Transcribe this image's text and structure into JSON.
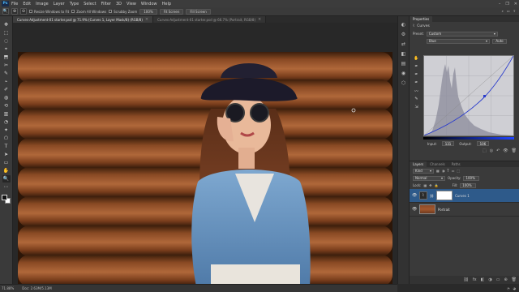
{
  "menu": {
    "logo": "Ps",
    "items": [
      "File",
      "Edit",
      "Image",
      "Layer",
      "Type",
      "Select",
      "Filter",
      "3D",
      "View",
      "Window",
      "Help"
    ],
    "window_controls": [
      "–",
      "❐",
      "✕"
    ]
  },
  "options": {
    "resize_windows_label": "Resize Windows to Fit",
    "zoom_all_label": "Zoom All Windows",
    "scrubby_zoom_label": "Scrubby Zoom",
    "zoom_100": "100%",
    "fit_screen": "Fit Screen",
    "fill_screen": "Fill Screen"
  },
  "tabs": [
    {
      "label": "Curves-Adjustment-01 starter.psd @ 71.9% (Curves 1, Layer Mask/8) (RGB/8)",
      "active": true,
      "close": "×"
    },
    {
      "label": "Curves-Adjustment-01 starter.psd @ 66.7% (Portrait, RGB/8)",
      "active": false,
      "close": "×"
    }
  ],
  "tools": [
    "✥",
    "⬚",
    "◌",
    "⌖",
    "⬒",
    "✂",
    "✎",
    "⌁",
    "✐",
    "◍",
    "⟲",
    "▥",
    "◔",
    "✦",
    "⬠",
    "T",
    "➤",
    "▭",
    "✋",
    "🔍",
    "⋯"
  ],
  "strip_icons": [
    "◐",
    "⚙",
    "⇄",
    "◧",
    "▤",
    "◉",
    "⬡"
  ],
  "properties": {
    "tabs": [
      "Properties"
    ],
    "header_label": "Curves",
    "preset_label": "Preset:",
    "preset_value": "Custom",
    "channel_value": "Blue",
    "auto_label": "Auto",
    "curve_tools": [
      "✋",
      "✒",
      "✒",
      "✒",
      "〰",
      "✎",
      "⇲"
    ],
    "input_label": "Input:",
    "input_value": "131",
    "output_label": "Output:",
    "output_value": "106",
    "foot_icons": [
      "⬚",
      "◎",
      "↶",
      "👁",
      "🗑"
    ]
  },
  "layers": {
    "tabs": [
      "Layers",
      "Channels",
      "Paths"
    ],
    "filter_label": "Kind",
    "blend_mode": "Normal",
    "opacity_label": "Opacity:",
    "opacity_value": "100%",
    "lock_label": "Lock:",
    "fill_label": "Fill:",
    "fill_value": "100%",
    "rows": [
      {
        "name": "Curves 1",
        "type": "adjustment",
        "selected": true
      },
      {
        "name": "Portrait",
        "type": "image",
        "selected": false
      }
    ],
    "foot_icons": [
      "⛓",
      "fx",
      "◧",
      "◑",
      "▭",
      "⊕",
      "🗑"
    ]
  },
  "status": {
    "zoom": "71.88%",
    "doc_info": "Doc: 2.63M/5.13M"
  },
  "colors": {
    "accent": "#2e5a8a",
    "curve_blue": "#2a3ccc"
  }
}
